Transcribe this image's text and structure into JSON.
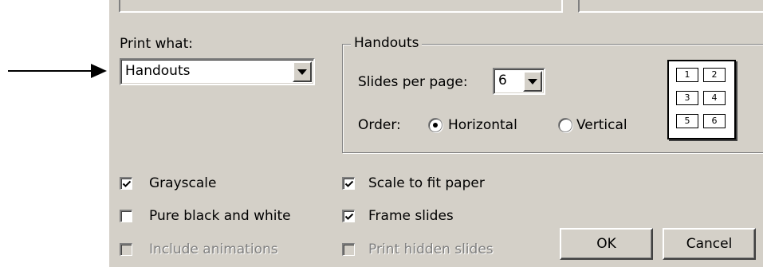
{
  "print_what": {
    "label": "Print what:",
    "selected": "Handouts"
  },
  "handouts": {
    "group_title": "Handouts",
    "slides_per_page_label": "Slides per page:",
    "slides_per_page_value": "6",
    "order_label": "Order:",
    "order_options": [
      "Horizontal",
      "Vertical"
    ],
    "order_selected": "Horizontal",
    "preview_numbers": [
      "1",
      "2",
      "3",
      "4",
      "5",
      "6"
    ]
  },
  "options": {
    "grayscale": {
      "label": "Grayscale",
      "checked": true,
      "enabled": true
    },
    "pure_bw": {
      "label": "Pure black and white",
      "checked": false,
      "enabled": true
    },
    "include_animations": {
      "label": "Include animations",
      "checked": false,
      "enabled": false
    },
    "scale_to_fit": {
      "label": "Scale to fit paper",
      "checked": true,
      "enabled": true
    },
    "frame_slides": {
      "label": "Frame slides",
      "checked": true,
      "enabled": true
    },
    "print_hidden": {
      "label": "Print hidden slides",
      "checked": false,
      "enabled": false
    }
  },
  "buttons": {
    "ok": "OK",
    "cancel": "Cancel"
  },
  "annotation": {
    "icon": "arrow-right-icon"
  },
  "colors": {
    "dialog_bg": "#d4d0c8",
    "disabled_text": "#808080"
  }
}
